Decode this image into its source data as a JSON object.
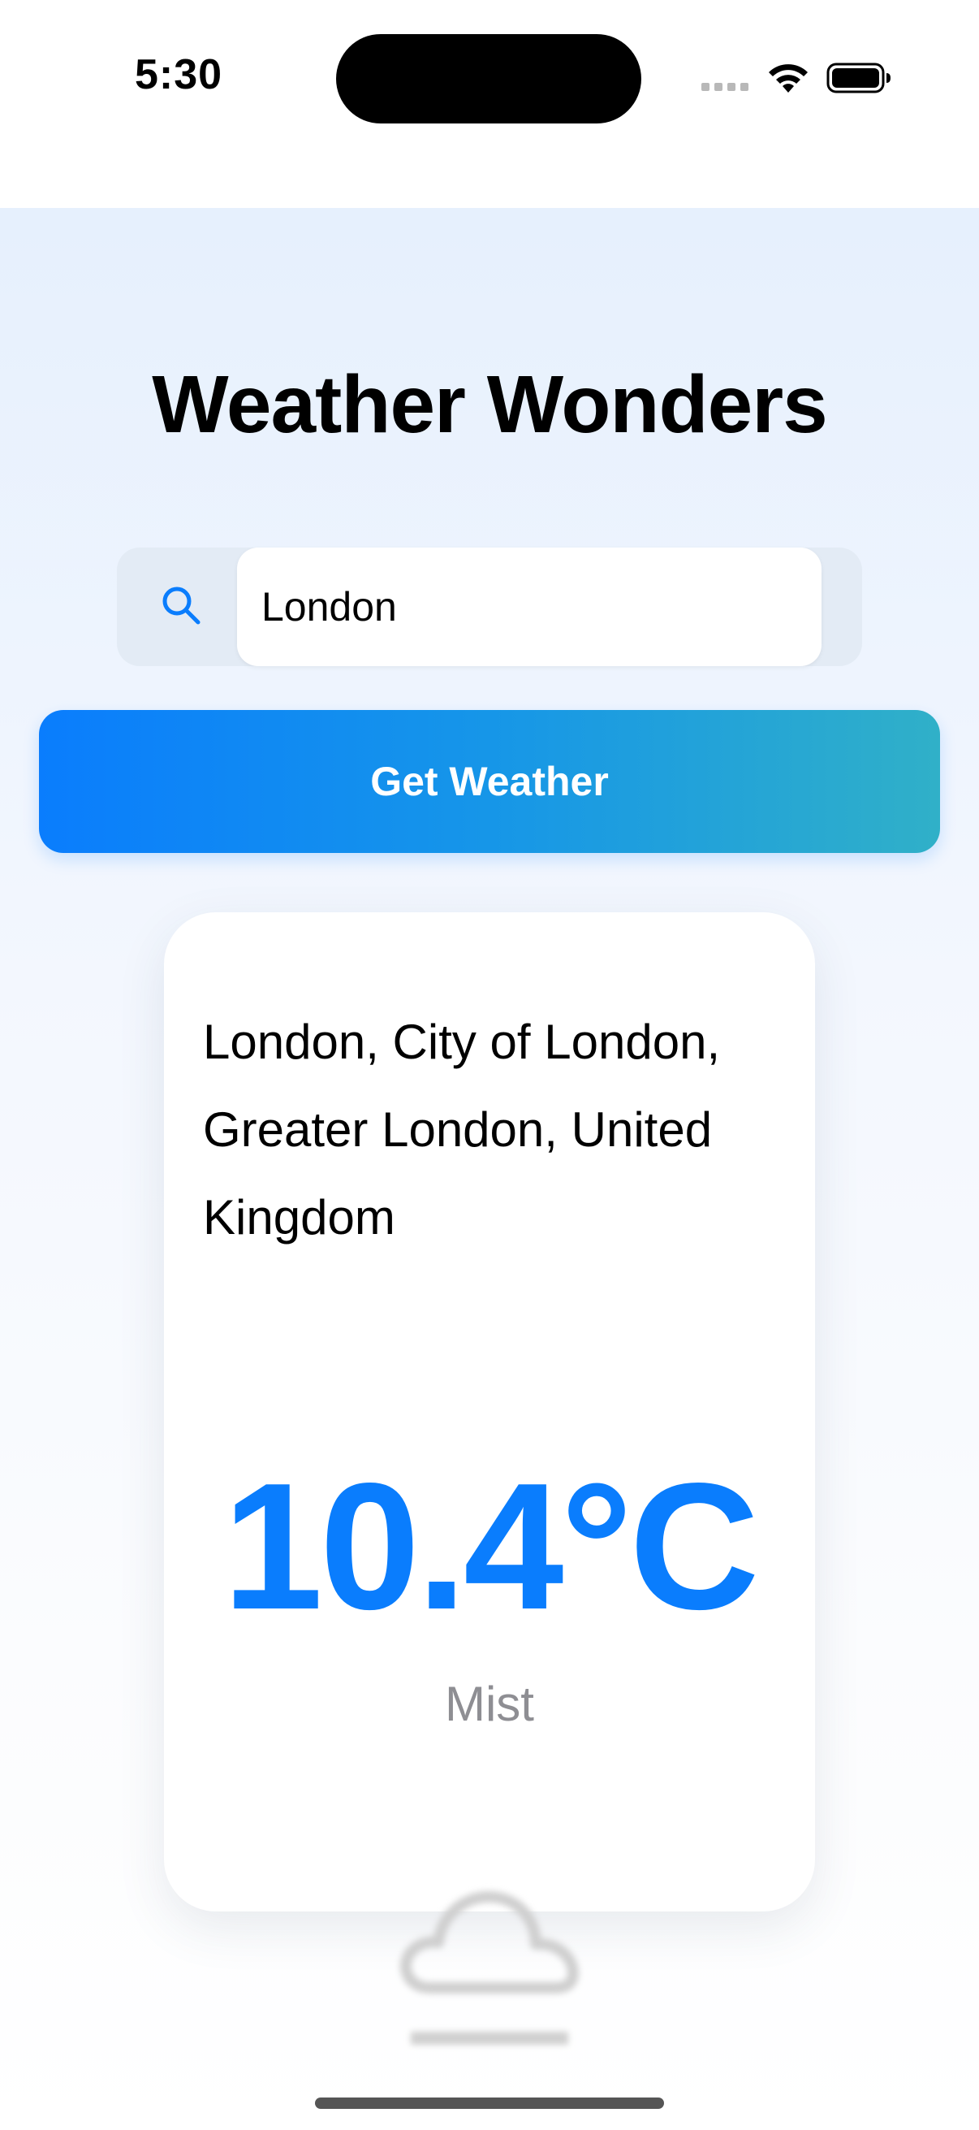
{
  "status_bar": {
    "time": "5:30",
    "icons": [
      "signal-dots-icon",
      "wifi-icon",
      "battery-icon"
    ]
  },
  "app": {
    "title": "Weather Wonders"
  },
  "search": {
    "value": "London",
    "icon": "search-icon"
  },
  "button": {
    "label": "Get Weather"
  },
  "weather": {
    "location": "London, City of London, Greater London, United Kingdom",
    "temperature": "10.4°C",
    "condition": "Mist",
    "icon": "mist-cloud-icon"
  },
  "colors": {
    "accent": "#0a7dfd",
    "button_gradient_end": "#30b0c8",
    "condition_text": "#8e8e93"
  }
}
